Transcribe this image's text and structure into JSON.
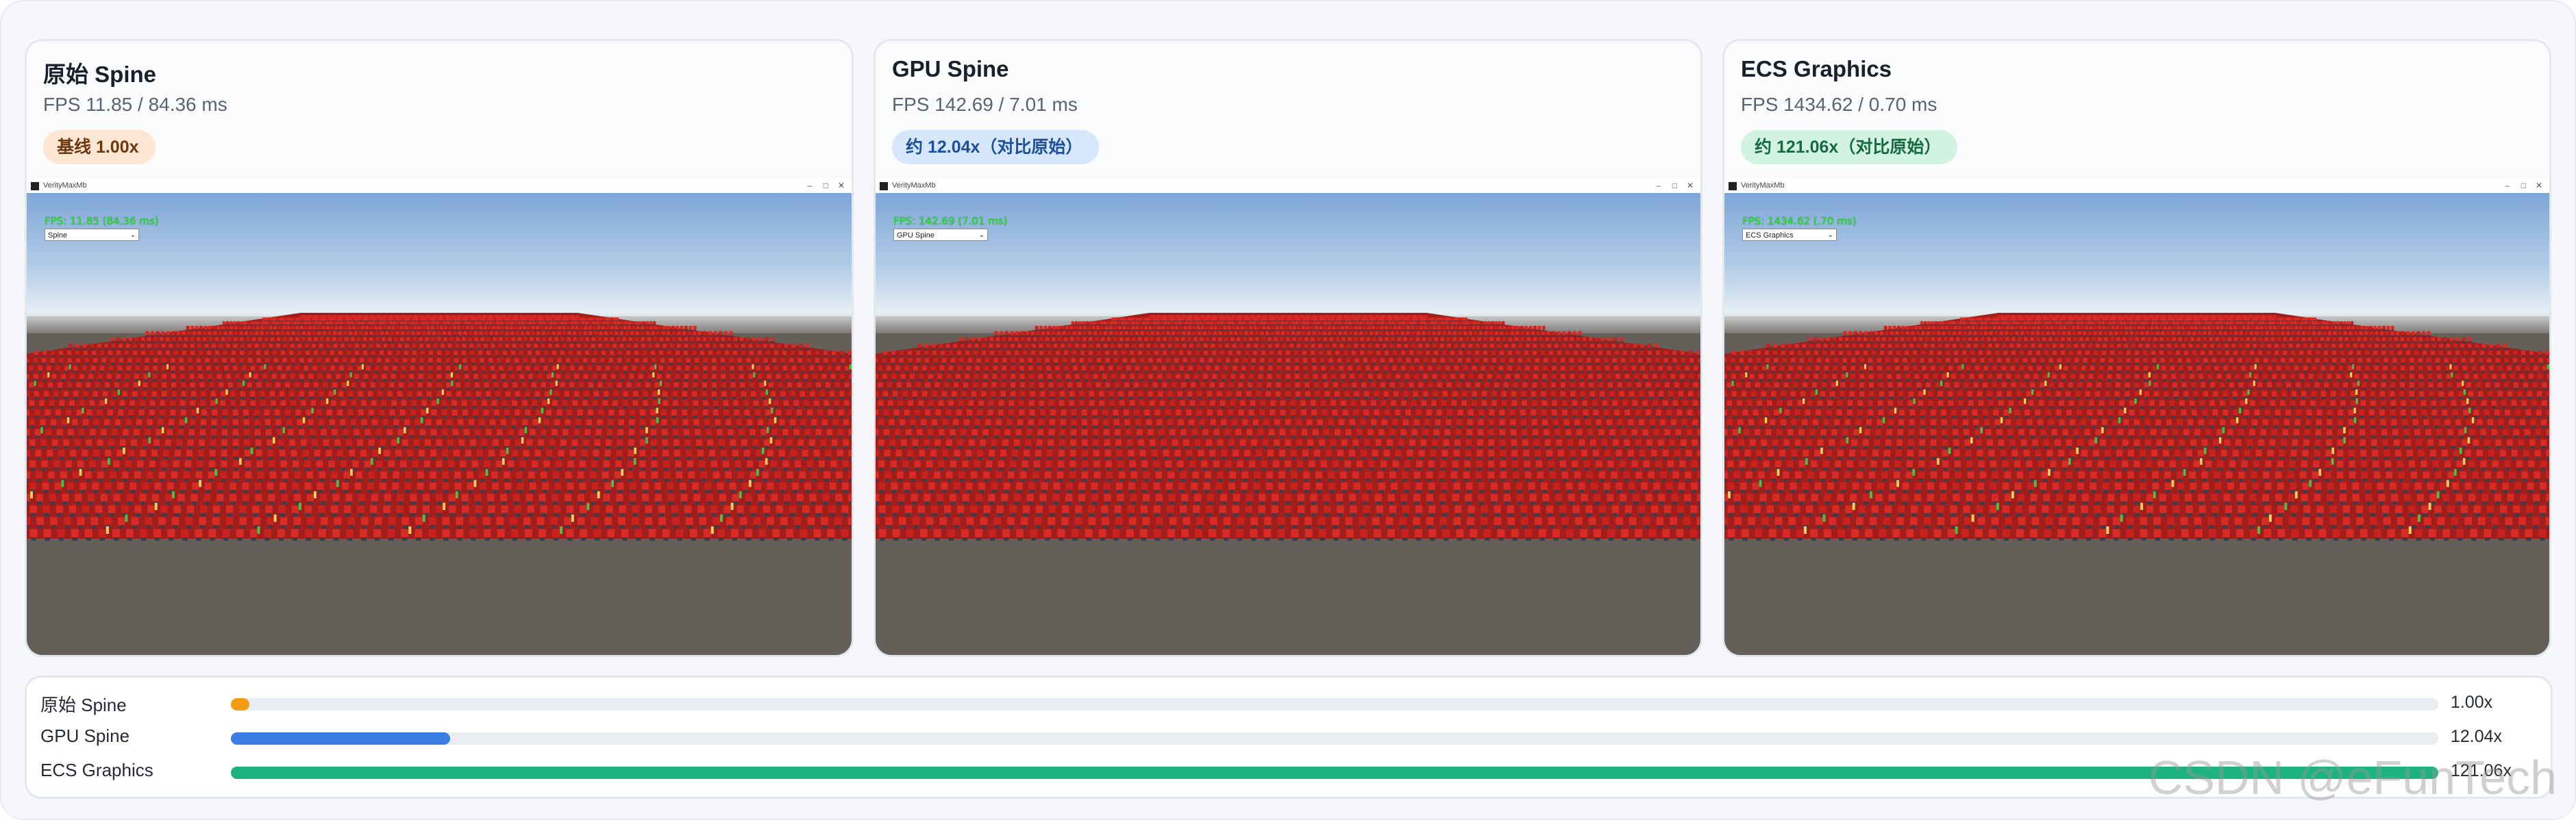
{
  "cards": [
    {
      "title": "原始 Spine",
      "fps": "FPS 11.85 / 84.36 ms",
      "badge": "基线 1.00x",
      "window_title": "VerityMaxMb",
      "hud_fps": "FPS: 11.85 (84.36 ms)",
      "hud_select": "Spine",
      "style": "orange",
      "accent_color": "#f39c12"
    },
    {
      "title": "GPU Spine",
      "fps": "FPS 142.69 / 7.01 ms",
      "badge": "约 12.04x（对比原始）",
      "window_title": "VerityMaxMb",
      "hud_fps": "FPS: 142.69 (7.01 ms)",
      "hud_select": "GPU Spine",
      "style": "blue",
      "accent_color": "#3a7ee4"
    },
    {
      "title": "ECS Graphics",
      "fps": "FPS 1434.62 / 0.70 ms",
      "badge": "约 121.06x（对比原始）",
      "window_title": "VerityMaxMb",
      "hud_fps": "FPS: 1434.62 (.70 ms)",
      "hud_select": "ECS Graphics",
      "style": "green",
      "accent_color": "#1db37e"
    }
  ],
  "comparison": {
    "max_value": 121.06,
    "rows": [
      {
        "label": "原始 Spine",
        "value_text": "1.00x",
        "value": 1.0,
        "color": "#f39c12"
      },
      {
        "label": "GPU Spine",
        "value_text": "12.04x",
        "value": 12.04,
        "color": "#3a7ee4"
      },
      {
        "label": "ECS Graphics",
        "value_text": "121.06x",
        "value": 121.06,
        "color": "#1db37e"
      }
    ]
  },
  "watermark": "CSDN @eFunTech"
}
